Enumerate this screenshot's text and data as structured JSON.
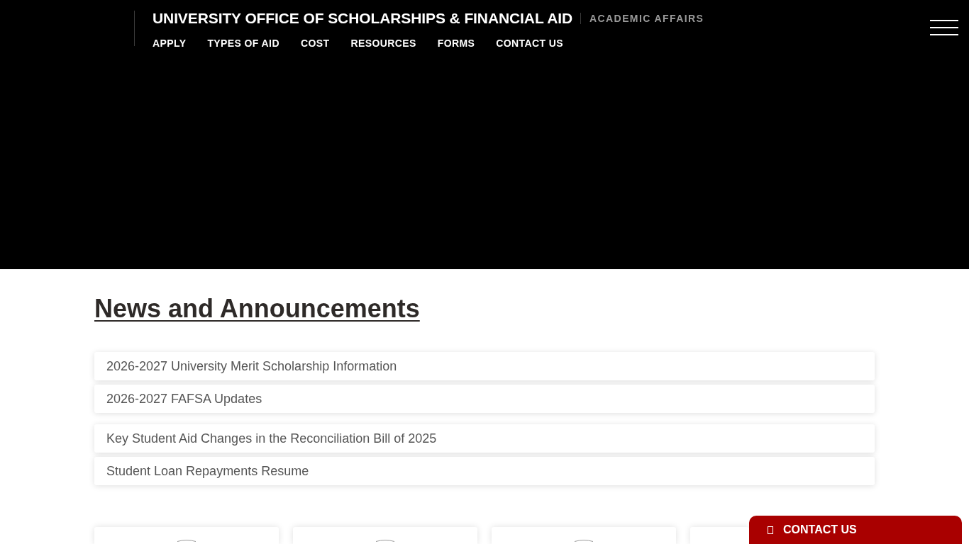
{
  "header": {
    "title": "UNIVERSITY OFFICE OF SCHOLARSHIPS & FINANCIAL AID",
    "parent_unit": "ACADEMIC AFFAIRS",
    "nav": [
      "APPLY",
      "TYPES OF AID",
      "COST",
      "RESOURCES",
      "FORMS",
      "CONTACT US"
    ]
  },
  "news": {
    "heading": "News and Announcements",
    "groups": [
      {
        "items": [
          "2026-2027 University Merit Scholarship Information",
          "2026-2027 FAFSA Updates"
        ]
      },
      {
        "items": [
          "Key Student Aid Changes in the Reconciliation Bill of 2025",
          "Student Loan Repayments Resume"
        ]
      }
    ]
  },
  "feature_cards": [
    {
      "kind": "circle-image"
    },
    {
      "kind": "circle-image"
    },
    {
      "kind": "circle-image"
    },
    {
      "kind": "blank"
    }
  ],
  "contact_button": {
    "label": "CONTACT US"
  }
}
